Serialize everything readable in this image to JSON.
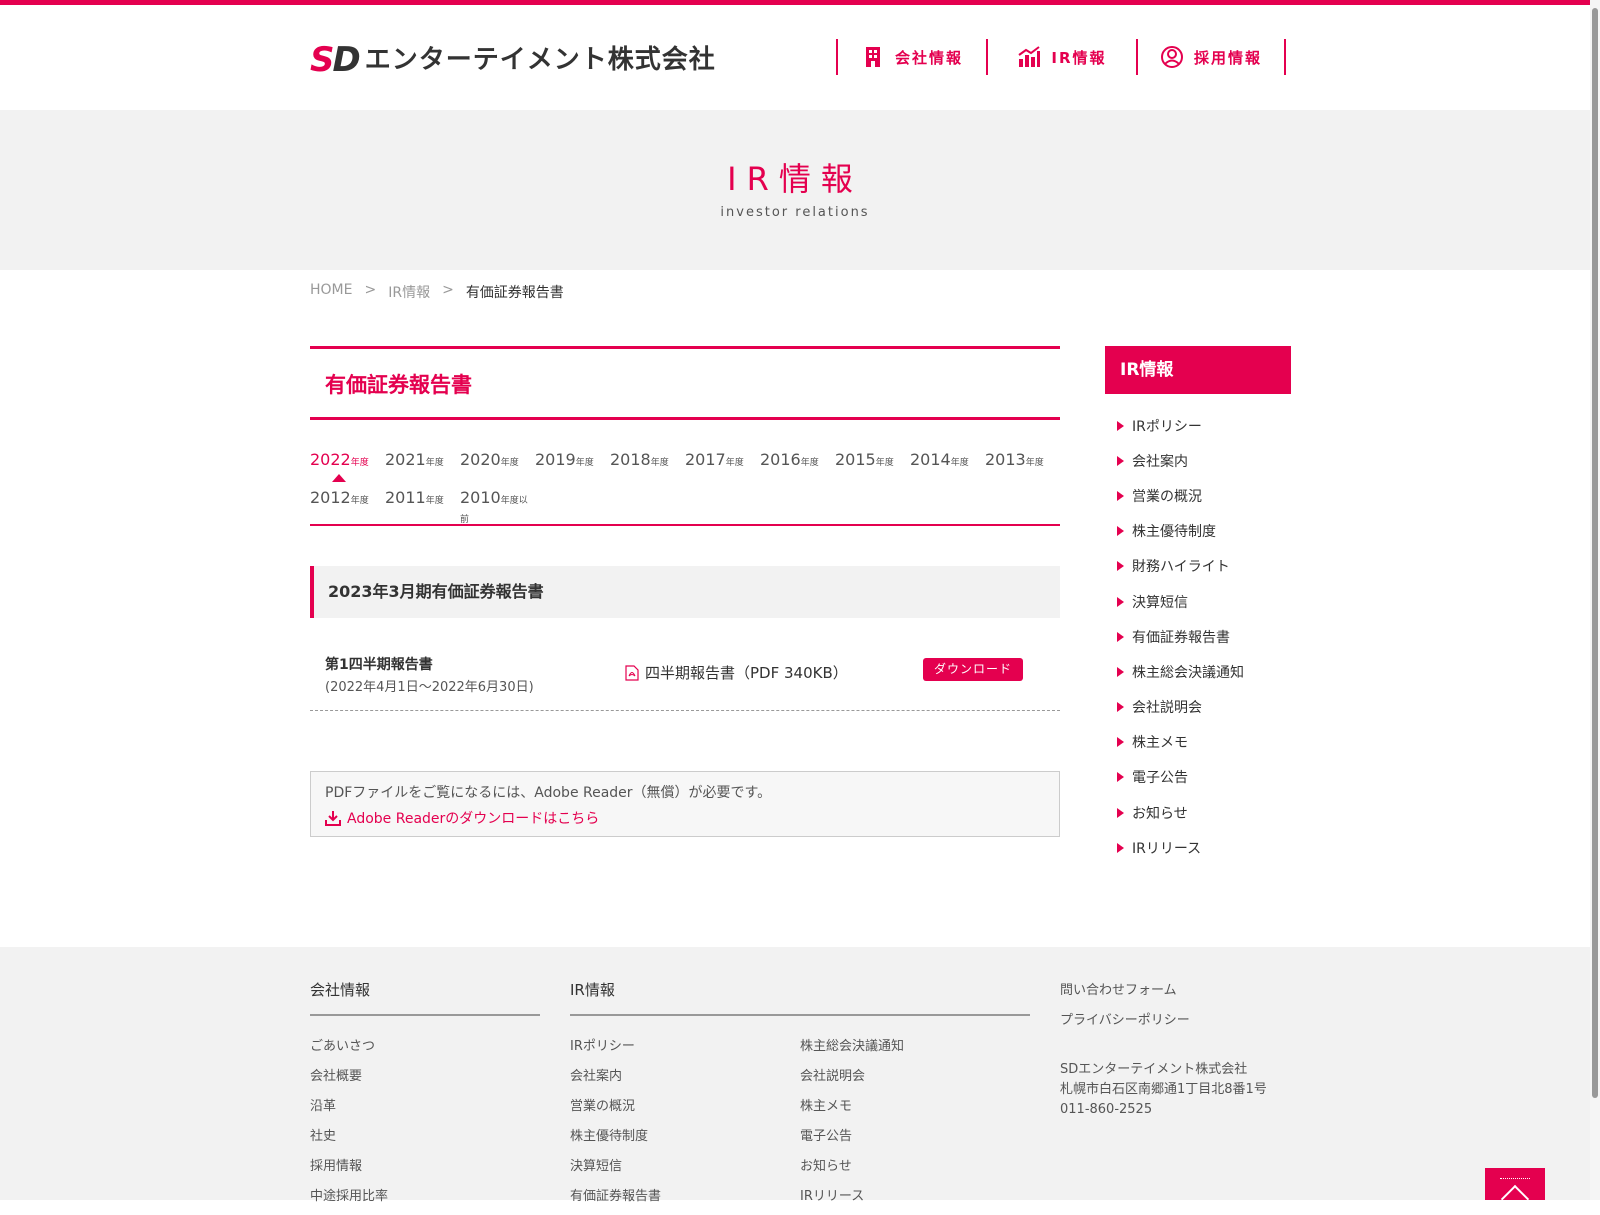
{
  "header": {
    "logo_mark_s": "S",
    "logo_mark_d": "D",
    "logo_text": "エンターテイメント株式会社",
    "nav": [
      {
        "label": "会社情報",
        "icon": "building-icon"
      },
      {
        "label": "IR情報",
        "icon": "chart-icon"
      },
      {
        "label": "採用情報",
        "icon": "person-icon"
      }
    ]
  },
  "hero": {
    "title": "IR情報",
    "subtitle": "investor relations"
  },
  "breadcrumb": {
    "home": "HOME",
    "sep": ">",
    "ir": "IR情報",
    "current": "有価証券報告書"
  },
  "main": {
    "page_title": "有価証券報告書",
    "years": [
      {
        "year": "2022",
        "suffix": "年度",
        "active": true
      },
      {
        "year": "2021",
        "suffix": "年度"
      },
      {
        "year": "2020",
        "suffix": "年度"
      },
      {
        "year": "2019",
        "suffix": "年度"
      },
      {
        "year": "2018",
        "suffix": "年度"
      },
      {
        "year": "2017",
        "suffix": "年度"
      },
      {
        "year": "2016",
        "suffix": "年度"
      },
      {
        "year": "2015",
        "suffix": "年度"
      },
      {
        "year": "2014",
        "suffix": "年度"
      },
      {
        "year": "2013",
        "suffix": "年度"
      },
      {
        "year": "2012",
        "suffix": "年度"
      },
      {
        "year": "2011",
        "suffix": "年度"
      },
      {
        "year": "2010",
        "suffix": "年度以前"
      }
    ],
    "section_title": "2023年3月期有価証券報告書",
    "report": {
      "name": "第1四半期報告書",
      "period": "(2022年4月1日〜2022年6月30日)",
      "file": "四半期報告書（PDF 340KB）",
      "download": "ダウンロード"
    },
    "adobe": {
      "note": "PDFファイルをご覧になるには、Adobe Reader（無償）が必要です。",
      "link": "Adobe Readerのダウンロードはこちら"
    }
  },
  "side": {
    "title": "IR情報",
    "items": [
      "IRポリシー",
      "会社案内",
      "営業の概況",
      "株主優待制度",
      "財務ハイライト",
      "決算短信",
      "有価証券報告書",
      "株主総会決議通知",
      "会社説明会",
      "株主メモ",
      "電子公告",
      "お知らせ",
      "IRリリース"
    ]
  },
  "footer": {
    "company_title": "会社情報",
    "company_items": [
      "ごあいさつ",
      "会社概要",
      "沿革",
      "社史",
      "採用情報",
      "中途採用比率"
    ],
    "ir_title": "IR情報",
    "ir_items_1": [
      "IRポリシー",
      "会社案内",
      "営業の概況",
      "株主優待制度",
      "決算短信",
      "有価証券報告書"
    ],
    "ir_items_2": [
      "株主総会決議通知",
      "会社説明会",
      "株主メモ",
      "電子公告",
      "お知らせ",
      "IRリリース"
    ],
    "contact": "問い合わせフォーム",
    "privacy": "プライバシーポリシー",
    "company_name": "SDエンターテイメント株式会社",
    "address": "札幌市白石区南郷通1丁目北8番1号",
    "tel": "011-860-2525"
  },
  "colors": {
    "accent": "#e4004f",
    "bg_gray": "#f2f2f2"
  }
}
